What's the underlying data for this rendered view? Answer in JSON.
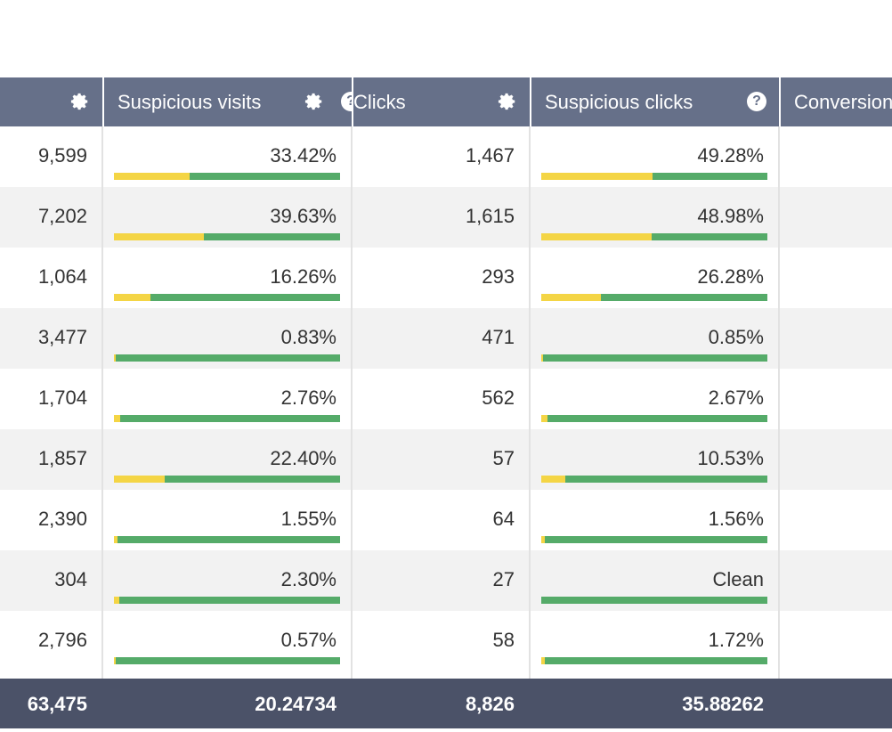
{
  "columns": [
    {
      "label": "",
      "icon": "gear-icon"
    },
    {
      "label": "Suspicious visits",
      "icon": "gear-icon",
      "icon2": "help-icon"
    },
    {
      "label": "Clicks",
      "icon": "gear-icon"
    },
    {
      "label": "Suspicious clicks",
      "icon": "help-icon",
      "help_glyph": "?"
    },
    {
      "label": "Conversions"
    }
  ],
  "rows": [
    {
      "visits": "9,599",
      "suspicious_visits": "33.42%",
      "sv_pct": 33.42,
      "clicks": "1,467",
      "suspicious_clicks": "49.28%",
      "sc_pct": 49.28
    },
    {
      "visits": "7,202",
      "suspicious_visits": "39.63%",
      "sv_pct": 39.63,
      "clicks": "1,615",
      "suspicious_clicks": "48.98%",
      "sc_pct": 48.98
    },
    {
      "visits": "1,064",
      "suspicious_visits": "16.26%",
      "sv_pct": 16.26,
      "clicks": "293",
      "suspicious_clicks": "26.28%",
      "sc_pct": 26.28
    },
    {
      "visits": "3,477",
      "suspicious_visits": "0.83%",
      "sv_pct": 0.83,
      "clicks": "471",
      "suspicious_clicks": "0.85%",
      "sc_pct": 0.85
    },
    {
      "visits": "1,704",
      "suspicious_visits": "2.76%",
      "sv_pct": 2.76,
      "clicks": "562",
      "suspicious_clicks": "2.67%",
      "sc_pct": 2.67
    },
    {
      "visits": "1,857",
      "suspicious_visits": "22.40%",
      "sv_pct": 22.4,
      "clicks": "57",
      "suspicious_clicks": "10.53%",
      "sc_pct": 10.53
    },
    {
      "visits": "2,390",
      "suspicious_visits": "1.55%",
      "sv_pct": 1.55,
      "clicks": "64",
      "suspicious_clicks": "1.56%",
      "sc_pct": 1.56
    },
    {
      "visits": "304",
      "suspicious_visits": "2.30%",
      "sv_pct": 2.3,
      "clicks": "27",
      "suspicious_clicks": "Clean",
      "sc_pct": 0
    },
    {
      "visits": "2,796",
      "suspicious_visits": "0.57%",
      "sv_pct": 0.57,
      "clicks": "58",
      "suspicious_clicks": "1.72%",
      "sc_pct": 1.72
    }
  ],
  "totals": {
    "visits": "63,475",
    "suspicious_visits": "20.24734",
    "clicks": "8,826",
    "suspicious_clicks": "35.88262"
  },
  "colors": {
    "header": "#667089",
    "footer": "#4b5268",
    "clean": "#55ab69",
    "suspicious": "#f4d545"
  }
}
